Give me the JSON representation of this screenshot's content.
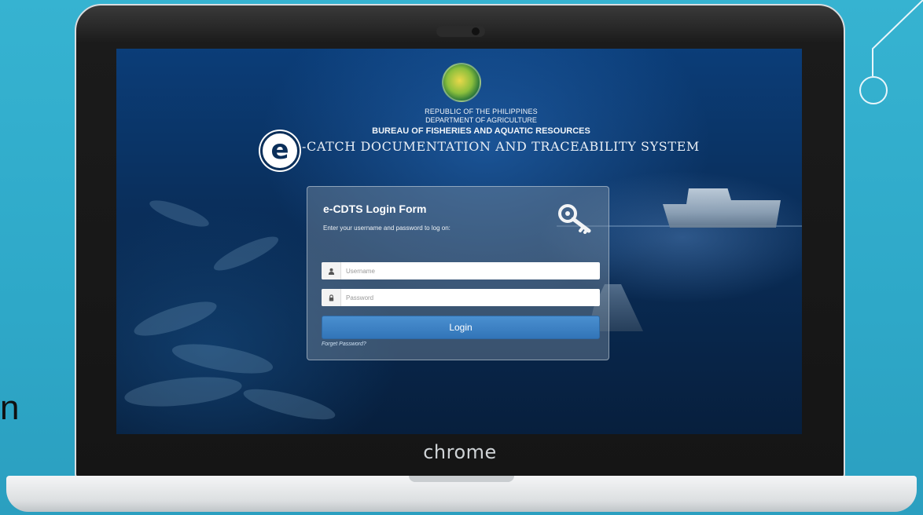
{
  "slide": {
    "side_text": "n"
  },
  "device": {
    "brand_label": "chrome"
  },
  "header": {
    "line1": "REPUBLIC OF THE PHILIPPINES",
    "line2": "DEPARTMENT OF AGRICULTURE",
    "line3": "BUREAU OF FISHERIES AND AQUATIC RESOURCES",
    "system_title": "-CATCH DOCUMENTATION AND TRACEABILITY SYSTEM",
    "logo_letter": "e"
  },
  "login_form": {
    "title": "e-CDTS Login Form",
    "subtitle": "Enter your username and password to log on:",
    "username_placeholder": "Username",
    "password_placeholder": "Password",
    "login_label": "Login",
    "forgot_label": "Forget Password?"
  },
  "colors": {
    "slide_background": "#36b3d1",
    "login_button": "#3a80c2"
  }
}
